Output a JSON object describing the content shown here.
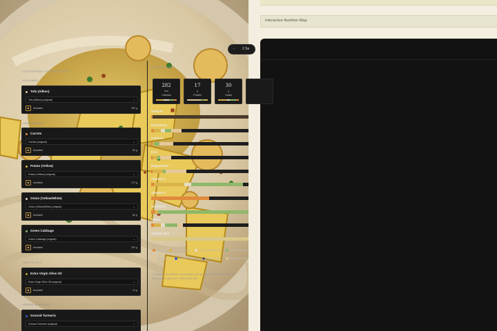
{
  "header": {
    "title": "Interactive Nutrition Map"
  },
  "servings": {
    "minus_label": "-",
    "value": "2 Se"
  },
  "customize_title": "CUSTOMIZE INGREDIENTS",
  "per_serving_title": "PER SERVING",
  "categories": {
    "legumes": "LEGUMES",
    "vegetables": "VEGETABLES",
    "oils": "OILS & FATS",
    "herbs": "HERBS & SPICES"
  },
  "ingredients": [
    {
      "name": "Tofu (Silken)",
      "option": "Tofu (Silken) (original)",
      "included_label": "Included",
      "amount": "300 g",
      "color": "#e4c79a"
    },
    {
      "name": "Carrots",
      "option": "Carrots (original)",
      "included_label": "Included",
      "amount": "80 g",
      "color": "#e08a3c"
    },
    {
      "name": "Potato (Yellow)",
      "option": "Potato (Yellow) (original)",
      "included_label": "Included",
      "amount": "170 g",
      "color": "#d9b44a"
    },
    {
      "name": "Onion (Yellow/White)",
      "option": "Onion (Yellow/White) (original)",
      "included_label": "Included",
      "amount": "80 g",
      "color": "#e6dcc7"
    },
    {
      "name": "Green Cabbage",
      "option": "Green Cabbage (original)",
      "included_label": "Included",
      "amount": "200 g",
      "color": "#8fb86a"
    },
    {
      "name": "Extra Virgin Olive Oil",
      "option": "Extra Virgin Olive Oil (original)",
      "included_label": "Included",
      "amount": "14 g",
      "color": "#c9a227"
    },
    {
      "name": "Ground Turmeric",
      "option": "Ground Turmeric (original)",
      "included_label": "Included",
      "amount": "",
      "color": "#3b5bd1"
    }
  ],
  "stats": [
    {
      "value": "282",
      "unit": "kcal",
      "label": "Calories"
    },
    {
      "value": "17",
      "unit": "g",
      "label": "Protein"
    },
    {
      "value": "30",
      "unit": "g",
      "label": "Carbs"
    },
    {
      "value": "",
      "unit": "",
      "label": ""
    }
  ],
  "nutrients": [
    {
      "name": "Sodium"
    },
    {
      "name": "Potassium"
    },
    {
      "name": "Calcium"
    },
    {
      "name": "Iron"
    },
    {
      "name": "Magnesium"
    },
    {
      "name": "Vitamin C"
    },
    {
      "name": "Vitamin A"
    },
    {
      "name": "Vitamin K"
    },
    {
      "name": "Folate"
    },
    {
      "name": "Vitamin B12"
    }
  ],
  "legend": [
    {
      "label": "Carrots",
      "color": "#e08a3c"
    },
    {
      "label": "Potato (Yellow)",
      "color": "#d9b44a"
    },
    {
      "label": "Onion (Yellow/White)",
      "color": "#e6dcc7"
    },
    {
      "label": "Green Cabbage",
      "color": "#8fb86a"
    },
    {
      "label": "Tofu (Silken)",
      "color": "#e4c79a"
    },
    {
      "label": "Ground Turmeric",
      "color": "#3b5bd1"
    },
    {
      "label": "Black Pepper",
      "color": "#333333"
    },
    {
      "label": "Nutritional Yeast",
      "color": "#d8c88a"
    }
  ],
  "footnote": "* Nutrition is an estimate; actual values vary by ingredient brands and cooking. Percentages based on a 2,000 calorie diet."
}
